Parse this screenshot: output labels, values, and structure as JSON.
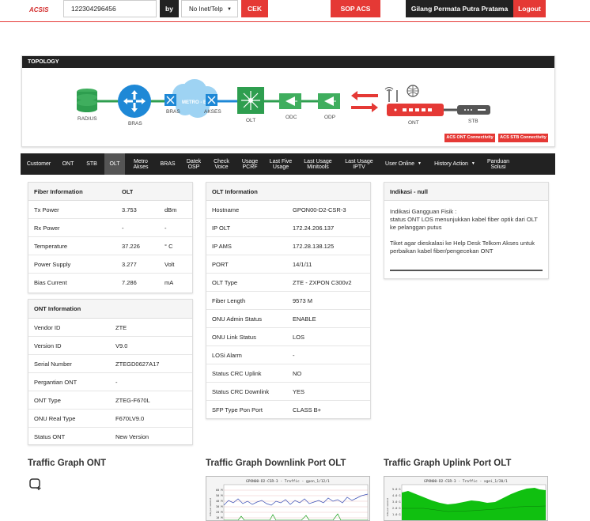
{
  "header": {
    "logo": "ACSIS",
    "search_value": "122304296456",
    "by_label": "by",
    "select_value": "No Inet/Telp",
    "cek_label": "CEK",
    "sop_label": "SOP ACS",
    "user_name": "Gilang Permata Putra Pratama",
    "logout_label": "Logout"
  },
  "topology": {
    "title": "TOPOLOGY",
    "nodes": {
      "radius": "RADIUS",
      "bras1": "BRAS",
      "bras2": "BRAS",
      "metro": "METRO - E",
      "akses": "AKSES",
      "olt": "OLT",
      "odc": "ODC",
      "odp": "ODP",
      "ont": "ONT",
      "stb": "STB"
    },
    "btn_ont": "ACS ONT Connectivity",
    "btn_stb": "ACS STB Connectivity",
    "colors": {
      "green": "#2e9e4f",
      "blue": "#1e88d6",
      "red": "#e53935",
      "dark": "#555555"
    }
  },
  "nav": {
    "items": [
      "Customer",
      "ONT",
      "STB",
      "OLT",
      "Metro Akses",
      "BRAS",
      "Datek OSP",
      "Check Voice",
      "Usage PCRF",
      "Last Five Usage",
      "Last Usage Minitools",
      "Last Usage IPTV",
      "User Online",
      "History Action",
      "Panduan Solusi"
    ],
    "active": "OLT"
  },
  "fiber": {
    "head_label": "Fiber Information",
    "head_value": "OLT",
    "rows": [
      {
        "label": "Tx Power",
        "value": "3.753",
        "unit": "dBm"
      },
      {
        "label": "Rx Power",
        "value": "-",
        "unit": "-"
      },
      {
        "label": "Temperature",
        "value": "37.226",
        "unit": "° C"
      },
      {
        "label": "Power Supply",
        "value": "3.277",
        "unit": "Volt"
      },
      {
        "label": "Bias Current",
        "value": "7.286",
        "unit": "mA"
      }
    ]
  },
  "ont_info": {
    "title": "ONT Information",
    "rows": [
      {
        "label": "Vendor ID",
        "value": "ZTE"
      },
      {
        "label": "Version ID",
        "value": "V9.0"
      },
      {
        "label": "Serial Number",
        "value": "ZTEGD0627A17"
      },
      {
        "label": "Pergantian ONT",
        "value": "-"
      },
      {
        "label": "ONT Type",
        "value": "ZTEG-F670L"
      },
      {
        "label": "ONU Real Type",
        "value": "F670LV9.0"
      },
      {
        "label": "Status ONT",
        "value": "New Version"
      }
    ]
  },
  "olt_info": {
    "title": "OLT Information",
    "rows": [
      {
        "label": "Hostname",
        "value": "GPON00-D2-CSR-3"
      },
      {
        "label": "IP OLT",
        "value": "172.24.206.137"
      },
      {
        "label": "IP AMS",
        "value": "172.28.138.125"
      },
      {
        "label": "PORT",
        "value": "14/1/11"
      },
      {
        "label": "OLT Type",
        "value": "ZTE - ZXPON C300v2"
      },
      {
        "label": "Fiber Length",
        "value": "9573 M"
      },
      {
        "label": "ONU Admin Status",
        "value": "ENABLE"
      },
      {
        "label": "ONU Link Status",
        "value": "LOS"
      },
      {
        "label": "LOSi Alarm",
        "value": "-"
      },
      {
        "label": "Status CRC Uplink",
        "value": "NO"
      },
      {
        "label": "Status CRC Downlink",
        "value": "YES"
      },
      {
        "label": "SFP Type Pon Port",
        "value": "CLASS B+"
      }
    ]
  },
  "indikasi": {
    "title": "Indikasi - null",
    "line1": "Indikasi Gangguan Fisik :",
    "line2": "status ONT LOS menunjukkan kabel fiber optik dari OLT ke pelanggan putus",
    "line3": "Tiket agar dieskalasi ke Help Desk Telkom Akses untuk perbaikan kabel fiber/pengecekan ONT"
  },
  "graphs": {
    "ont_title": "Traffic Graph ONT",
    "down_title": "Traffic Graph Downlink Port OLT",
    "up_title": "Traffic Graph Uplink Port OLT",
    "down_inner_title": "GPON00-D2-CSR-3 - Traffic - gpon_1/12/1",
    "up_inner_title": "GPON00-D2-CSR-3 - Traffic - xgei_1/20/1",
    "down_yticks": [
      "60 M",
      "50 M",
      "40 M",
      "30 M",
      "20 M",
      "10 M"
    ],
    "up_yticks": [
      "5.0 G",
      "4.0 G",
      "3.0 G",
      "2.0 G",
      "1.0 G"
    ],
    "axis_unit": "bits per second"
  }
}
